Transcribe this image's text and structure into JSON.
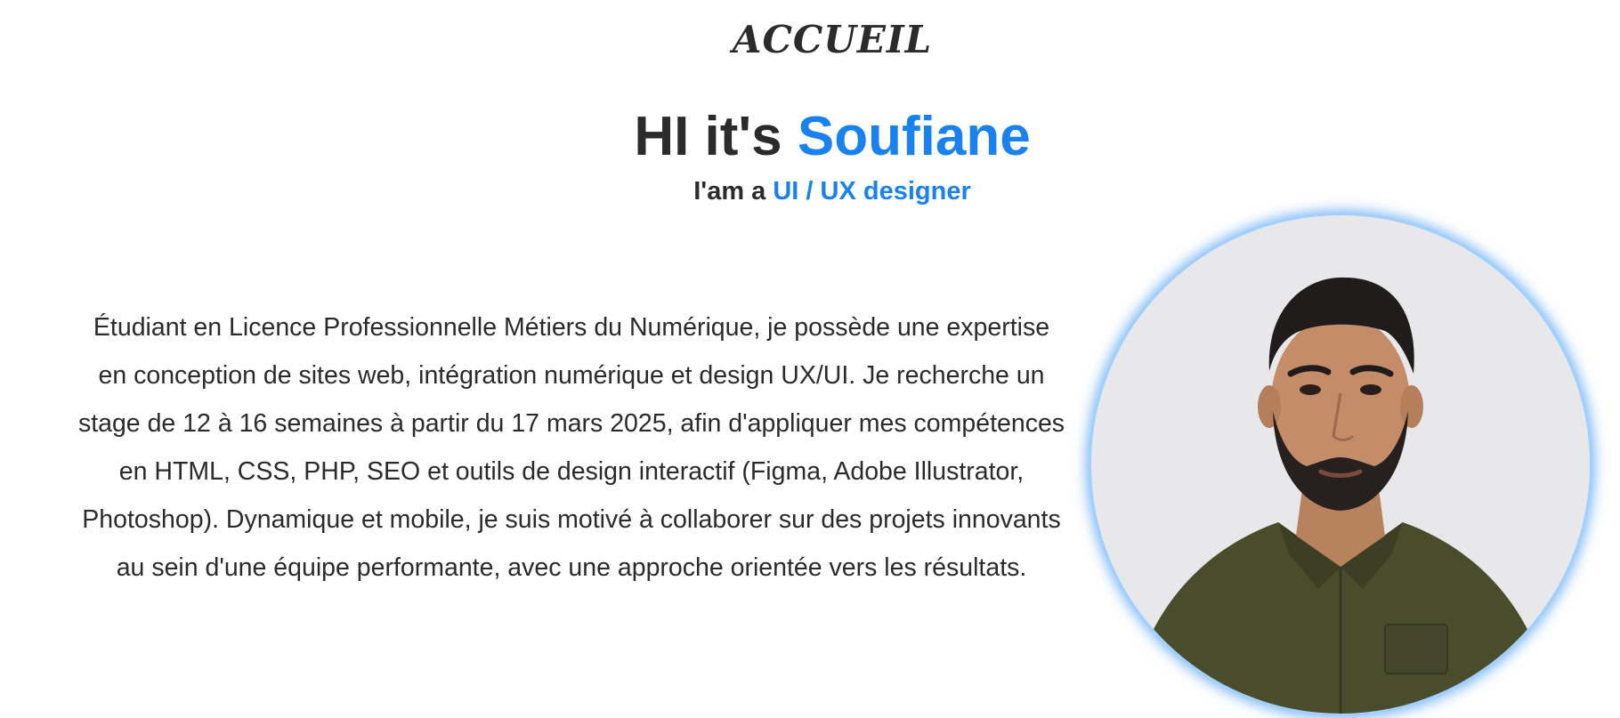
{
  "section": {
    "title": "ACCUEIL"
  },
  "hero": {
    "heading_prefix": "HI it's ",
    "heading_name": "Soufiane",
    "sub_prefix": "I'am a ",
    "sub_role": "UI / UX designer"
  },
  "bio": {
    "text": "Étudiant en Licence Professionnelle Métiers du Numérique, je possède une expertise en conception de sites web, intégration numérique et design UX/UI. Je recherche un stage de 12 à 16 semaines à partir du 17 mars 2025, afin d'appliquer mes compétences en HTML, CSS, PHP, SEO et outils de design interactif (Figma, Adobe Illustrator, Photoshop). Dynamique et mobile, je suis motivé à collaborer sur des projets innovants au sein d'une équipe performante, avec une approche orientée vers les résultats."
  },
  "colors": {
    "accent": "#1a82f0",
    "text": "#2b2b2b",
    "background": "#ffffff"
  }
}
